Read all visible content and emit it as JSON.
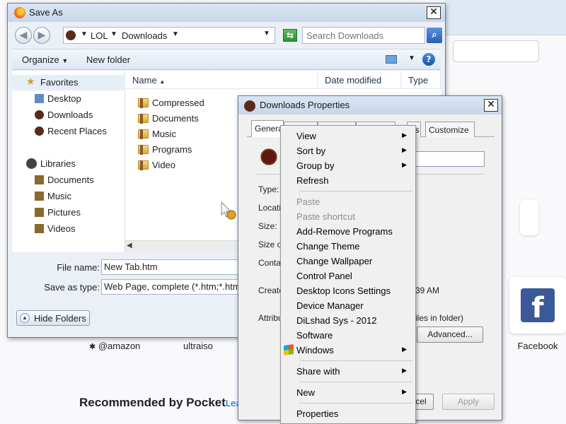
{
  "background": {
    "tiles": [
      {
        "label": "@amazon"
      },
      {
        "label": "ultraiso"
      },
      {
        "label": "Facebook"
      }
    ],
    "pocket_heading": "Recommended by Pocket",
    "pocket_link": "Lea",
    "facebook_glyph": "f"
  },
  "saveas": {
    "title": "Save As",
    "address": {
      "segments": [
        "LOL",
        "Downloads"
      ]
    },
    "search_placeholder": "Search Downloads",
    "toolbar": {
      "organize": "Organize",
      "new_folder": "New folder"
    },
    "nav": {
      "favorites": "Favorites",
      "favorites_items": [
        "Desktop",
        "Downloads",
        "Recent Places"
      ],
      "libraries": "Libraries",
      "library_items": [
        "Documents",
        "Music",
        "Pictures",
        "Videos"
      ]
    },
    "columns": {
      "name": "Name",
      "date": "Date modified",
      "type": "Type"
    },
    "files": [
      "Compressed",
      "Documents",
      "Music",
      "Programs",
      "Video"
    ],
    "file_name_label": "File name:",
    "file_name_value": "New Tab.htm",
    "save_type_label": "Save as type:",
    "save_type_value": "Web Page, complete (*.htm;*.htm",
    "hide_folders": "Hide Folders"
  },
  "props": {
    "title": "Downloads Properties",
    "tabs": [
      "General",
      "S",
      "",
      "P",
      "ns",
      "Customize"
    ],
    "labels": {
      "type": "Type:",
      "location": "Locati",
      "size": "Size:",
      "size_on": "Size o",
      "contains": "Contai",
      "created": "Create",
      "attributes": "Attribu"
    },
    "created_value": "39 AM",
    "attributes_note": "iles in folder)",
    "advanced": "Advanced...",
    "cancel": "cel",
    "apply": "Apply"
  },
  "context_menu": {
    "items": [
      {
        "label": "View",
        "sub": true
      },
      {
        "label": "Sort by",
        "sub": true
      },
      {
        "label": "Group by",
        "sub": true
      },
      {
        "label": "Refresh"
      },
      {
        "label": "Paste",
        "disabled": true
      },
      {
        "label": "Paste shortcut",
        "disabled": true
      },
      {
        "label": "Add-Remove Programs"
      },
      {
        "label": "Change Theme"
      },
      {
        "label": "Change Wallpaper"
      },
      {
        "label": "Control Panel"
      },
      {
        "label": "Desktop Icons Settings"
      },
      {
        "label": "Device Manager"
      },
      {
        "label": "DiLshad Sys - 2012"
      },
      {
        "label": "Software"
      },
      {
        "label": "Windows",
        "sub": true
      },
      {
        "label": "Share with",
        "sub": true
      },
      {
        "label": "New",
        "sub": true
      },
      {
        "label": "Properties"
      }
    ]
  }
}
